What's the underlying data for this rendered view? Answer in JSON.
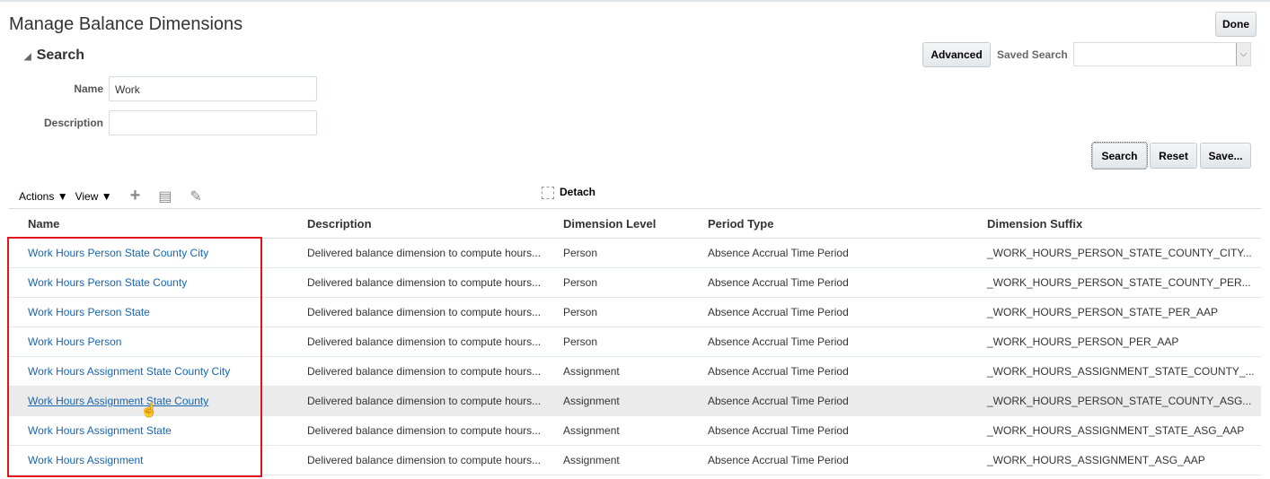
{
  "page": {
    "title": "Manage Balance Dimensions",
    "done_label": "Done"
  },
  "search": {
    "header": "Search",
    "name_label": "Name",
    "name_value": "Work",
    "description_label": "Description",
    "description_value": "",
    "advanced_label": "Advanced",
    "saved_search_label": "Saved Search",
    "saved_search_value": "",
    "search_button": "Search",
    "reset_button": "Reset",
    "save_button": "Save..."
  },
  "toolbar": {
    "actions_label": "Actions",
    "view_label": "View",
    "detach_label": "Detach"
  },
  "table": {
    "columns": [
      "Name",
      "Description",
      "Dimension Level",
      "Period Type",
      "Dimension Suffix"
    ],
    "rows": [
      {
        "name": "Work Hours Person State County City",
        "description": "Delivered balance dimension to compute hours...",
        "level": "Person",
        "period": "Absence Accrual Time Period",
        "suffix": "_WORK_HOURS_PERSON_STATE_COUNTY_CITY..."
      },
      {
        "name": "Work Hours Person State County",
        "description": "Delivered balance dimension to compute hours...",
        "level": "Person",
        "period": "Absence Accrual Time Period",
        "suffix": "_WORK_HOURS_PERSON_STATE_COUNTY_PER..."
      },
      {
        "name": "Work Hours Person State",
        "description": "Delivered balance dimension to compute hours...",
        "level": "Person",
        "period": "Absence Accrual Time Period",
        "suffix": "_WORK_HOURS_PERSON_STATE_PER_AAP"
      },
      {
        "name": "Work Hours Person",
        "description": "Delivered balance dimension to compute hours...",
        "level": "Person",
        "period": "Absence Accrual Time Period",
        "suffix": "_WORK_HOURS_PERSON_PER_AAP"
      },
      {
        "name": "Work Hours Assignment State County City",
        "description": "Delivered balance dimension to compute hours...",
        "level": "Assignment",
        "period": "Absence Accrual Time Period",
        "suffix": "_WORK_HOURS_ASSIGNMENT_STATE_COUNTY_..."
      },
      {
        "name": "Work Hours Assignment State County",
        "description": "Delivered balance dimension to compute hours...",
        "level": "Assignment",
        "period": "Absence Accrual Time Period",
        "suffix": "_WORK_HOURS_PERSON_STATE_COUNTY_ASG..."
      },
      {
        "name": "Work Hours Assignment State",
        "description": "Delivered balance dimension to compute hours...",
        "level": "Assignment",
        "period": "Absence Accrual Time Period",
        "suffix": "_WORK_HOURS_ASSIGNMENT_STATE_ASG_AAP"
      },
      {
        "name": "Work Hours Assignment",
        "description": "Delivered balance dimension to compute hours...",
        "level": "Assignment",
        "period": "Absence Accrual Time Period",
        "suffix": "_WORK_HOURS_ASSIGNMENT_ASG_AAP"
      }
    ]
  },
  "colors": {
    "link": "#1565b3",
    "highlight": "#e3151c",
    "selected_row": "#ebebeb"
  }
}
